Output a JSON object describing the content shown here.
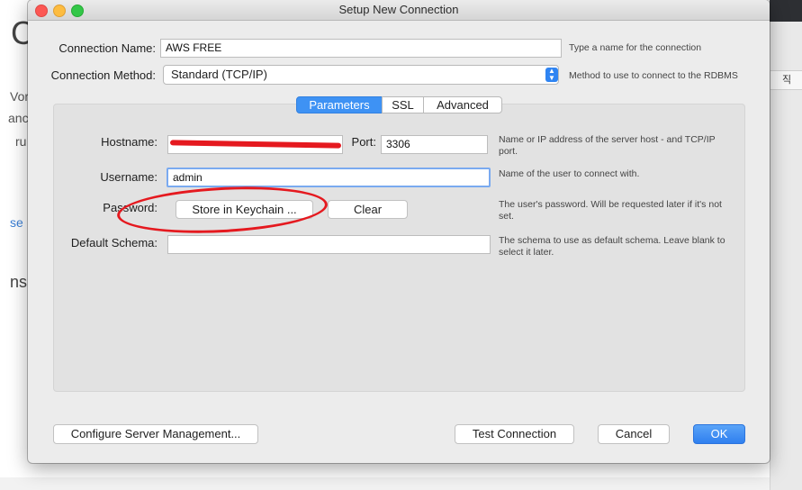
{
  "background": {
    "left_fragments": [
      "Vor",
      "anc",
      "ru",
      "se",
      "ns"
    ],
    "big_letter": "C",
    "right_cell_text": "직"
  },
  "dialog": {
    "title": "Setup New Connection",
    "connection_name_label": "Connection Name:",
    "connection_name_value": "AWS FREE",
    "connection_name_hint": "Type a name for the connection",
    "connection_method_label": "Connection Method:",
    "connection_method_value": "Standard (TCP/IP)",
    "connection_method_hint": "Method to use to connect to the RDBMS",
    "tabs": [
      "Parameters",
      "SSL",
      "Advanced"
    ],
    "active_tab": "Parameters",
    "params": {
      "hostname_label": "Hostname:",
      "port_label": "Port:",
      "port_value": "3306",
      "hostname_hint": "Name or IP address of the server host - and TCP/IP port.",
      "username_label": "Username:",
      "username_value": "admin",
      "username_hint": "Name of the user to connect with.",
      "password_label": "Password:",
      "store_keychain_label": "Store in Keychain ...",
      "clear_label": "Clear",
      "password_hint": "The user's password. Will be requested later if it's not set.",
      "schema_label": "Default Schema:",
      "schema_value": "",
      "schema_hint": "The schema to use as default schema. Leave blank to select it later."
    },
    "buttons": {
      "configure": "Configure Server Management...",
      "test": "Test Connection",
      "cancel": "Cancel",
      "ok": "OK"
    }
  },
  "colors": {
    "accent": "#3e92f4",
    "annotation_red": "#e5191f"
  }
}
